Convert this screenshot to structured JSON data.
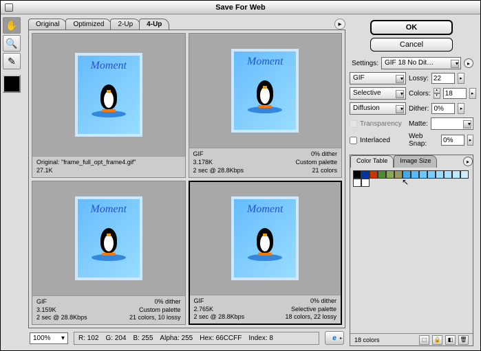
{
  "window": {
    "title": "Save For Web"
  },
  "tabs": [
    "Original",
    "Optimized",
    "2-Up",
    "4-Up"
  ],
  "active_tab_index": 3,
  "buttons": {
    "ok": "OK",
    "cancel": "Cancel"
  },
  "thumb_label": "Moment",
  "cells": [
    {
      "line1": "Original: \"frame_full_opt_frame4.gif\"",
      "size": "27.1K",
      "selected": false
    },
    {
      "fmt": "GIF",
      "dither": "0% dither",
      "size": "3.178K",
      "palette": "Custom palette",
      "time": "2 sec @ 28.8Kbps",
      "colors": "21 colors",
      "selected": false
    },
    {
      "fmt": "GIF",
      "dither": "0% dither",
      "size": "3.159K",
      "palette": "Custom palette",
      "time": "2 sec @ 28.8Kbps",
      "colors": "21 colors, 10 lossy",
      "selected": false
    },
    {
      "fmt": "GIF",
      "dither": "0% dither",
      "size": "2.765K",
      "palette": "Selective palette",
      "time": "2 sec @ 28.8Kbps",
      "colors": "18 colors, 22 lossy",
      "selected": true
    }
  ],
  "settings": {
    "label": "Settings:",
    "preset": "GIF 18 No Dit…",
    "format": "GIF",
    "lossy_label": "Lossy:",
    "lossy": "22",
    "reduction": "Selective",
    "colors_label": "Colors:",
    "colors": "18",
    "dither_method": "Diffusion",
    "dither_label": "Dither:",
    "dither": "0%",
    "transparency_label": "Transparency",
    "matte_label": "Matte:",
    "interlaced_label": "Interlaced",
    "websnap_label": "Web Snap:",
    "websnap": "0%"
  },
  "color_table": {
    "tab1": "Color Table",
    "tab2": "Image Size",
    "count": "18 colors",
    "swatches": [
      "#000000",
      "#0033aa",
      "#cc3300",
      "#558833",
      "#88aa55",
      "#999966",
      "#44aaee",
      "#55bbff",
      "#66ccff",
      "#77ccff",
      "#99ddff",
      "#aae0ff",
      "#bbeaff",
      "#cceeff",
      "#ffffff",
      "#ffffff"
    ]
  },
  "footer": {
    "zoom": "100%",
    "r": "R: 102",
    "g": "G: 204",
    "b": "B: 255",
    "alpha": "Alpha: 255",
    "hex": "Hex:  66CCFF",
    "index": "Index:    8",
    "browser": "e"
  }
}
